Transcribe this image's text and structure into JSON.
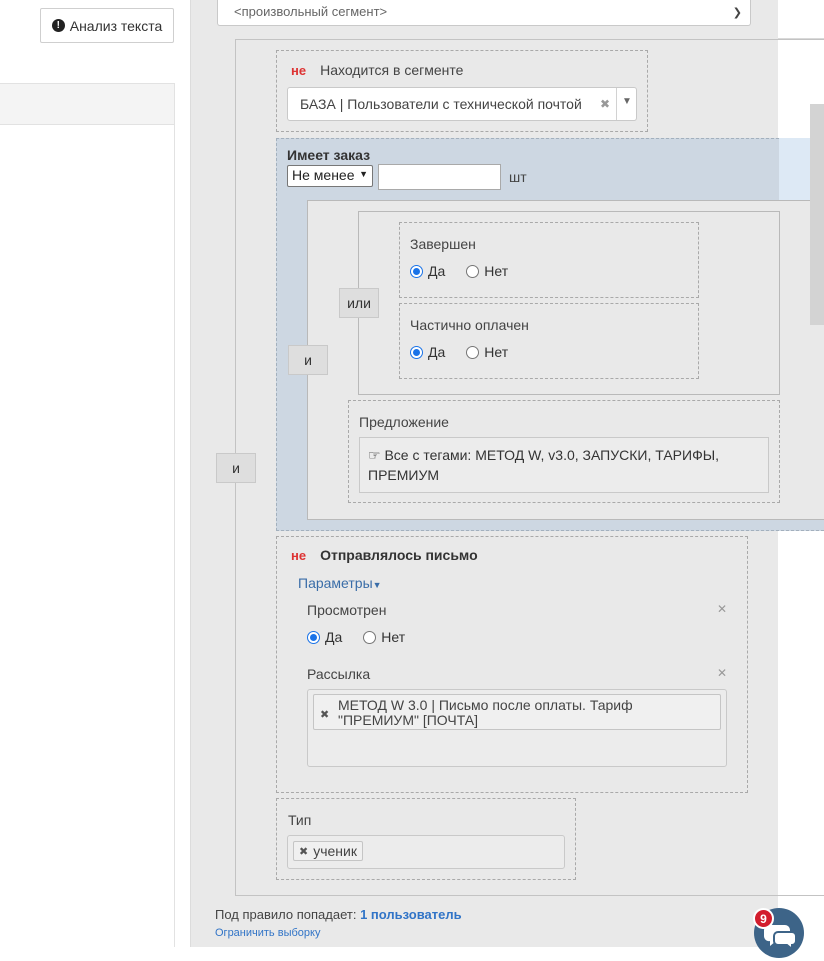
{
  "left": {
    "analyze_button": "Анализ текста"
  },
  "top_select": {
    "value": "<произвольный сегмент>"
  },
  "outer_group": {
    "operator": "и"
  },
  "segment_rule": {
    "negation": "не",
    "title": "Находится в сегменте",
    "selected_value": "БАЗА | Пользователи с технической почтой"
  },
  "order_rule": {
    "title": "Имеет заказ",
    "comparator": "Не менее",
    "count_value": "",
    "unit": "шт",
    "inner_operator": "и",
    "or_operator": "или",
    "status_completed": {
      "title": "Завершен",
      "yes": "Да",
      "no": "Нет",
      "selected": "yes"
    },
    "status_partial": {
      "title": "Частично оплачен",
      "yes": "Да",
      "no": "Нет",
      "selected": "yes"
    },
    "offer": {
      "title": "Предложение",
      "value": "Все с тегами: МЕТОД W, v3.0, ЗАПУСКИ, ТАРИФЫ, ПРЕМИУМ"
    }
  },
  "email_rule": {
    "negation": "не",
    "title": "Отправлялось письмо",
    "params_link": "Параметры",
    "viewed": {
      "title": "Просмотрен",
      "yes": "Да",
      "no": "Нет",
      "selected": "yes"
    },
    "mailing": {
      "title": "Рассылка",
      "tag": "МЕТОД W 3.0 | Письмо после оплаты. Тариф \"ПРЕМИУМ\" [ПОЧТА]"
    }
  },
  "type_rule": {
    "title": "Тип",
    "tag": "ученик"
  },
  "footer": {
    "result_prefix": "Под правило попадает:",
    "result_count": "1 пользователь",
    "limit_link": "Ограничить выборку"
  },
  "chat": {
    "badge_count": "9"
  },
  "colors": {
    "panel_bg": "#e9e9e9",
    "highlight_bg": "#cdd7e2",
    "negation_red": "#d33333",
    "link_blue": "#3174c7",
    "chat_bg": "#3d6488"
  }
}
